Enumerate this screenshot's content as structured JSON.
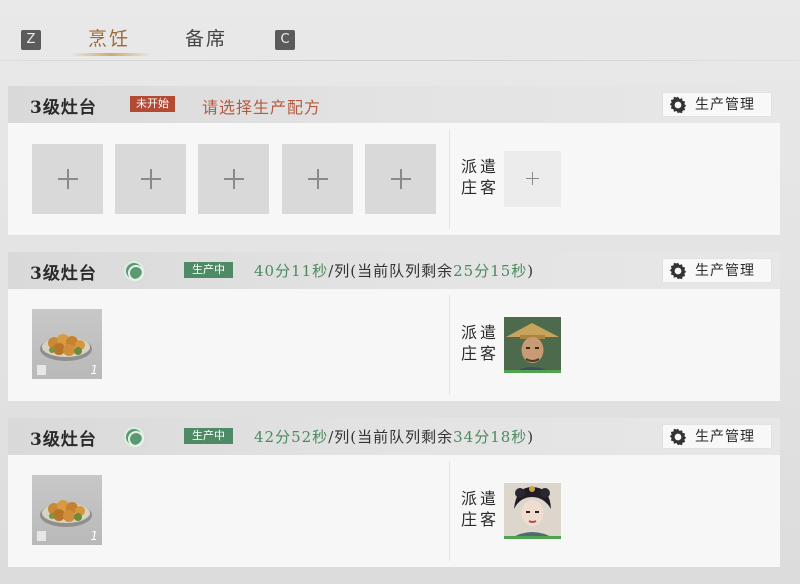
{
  "tabs": {
    "left_key": "Z",
    "right_key": "C",
    "items": [
      {
        "label": "烹饪",
        "active": true
      },
      {
        "label": "备席",
        "active": false
      }
    ]
  },
  "colors": {
    "accent_tab": "#9a6a39",
    "status_idle": "#b24a34",
    "status_active": "#4f8a66",
    "timer_green": "#4a8a5f"
  },
  "stoves": [
    {
      "title": "3级灶台",
      "status": "未开始",
      "hint": "请选择生产配方",
      "manage_label": "生产管理",
      "slot_icons": [
        "plus-icon",
        "plus-icon",
        "plus-icon",
        "plus-icon",
        "plus-icon"
      ],
      "dispatch_label": "派遣庄客",
      "assigned": false
    },
    {
      "title": "3级灶台",
      "status": "生产中",
      "time_per_row": "40分11秒",
      "per_row": "/列(当前队列剩余",
      "remaining": "25分15秒",
      "close": ")",
      "manage_label": "生产管理",
      "dish_count": "1",
      "dispatch_label": "派遣庄客",
      "assigned": true,
      "worker": "male-villager-portrait"
    },
    {
      "title": "3级灶台",
      "status": "生产中",
      "time_per_row": "42分52秒",
      "per_row": "/列(当前队列剩余",
      "remaining": "34分18秒",
      "close": ")",
      "manage_label": "生产管理",
      "dish_count": "1",
      "dispatch_label": "派遣庄客",
      "assigned": true,
      "worker": "female-villager-portrait"
    }
  ]
}
